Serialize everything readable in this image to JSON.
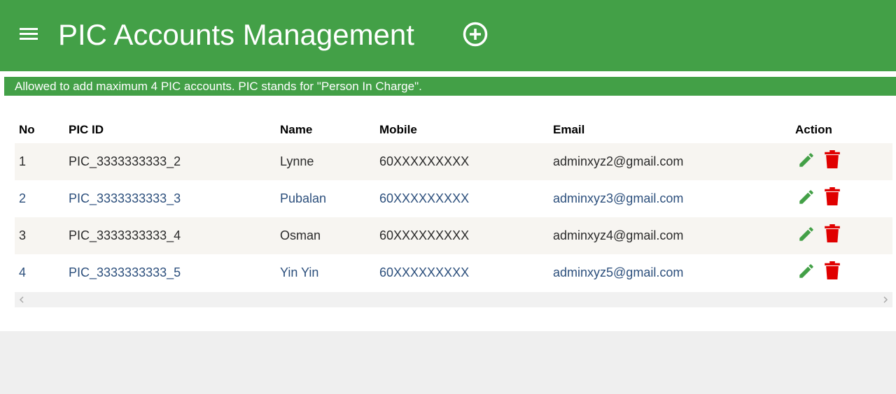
{
  "header": {
    "title": "PIC Accounts Management",
    "menu_icon": "hamburger-menu-icon",
    "add_icon": "add-circle-icon",
    "background_color": "#43a047"
  },
  "notice": {
    "text": "Allowed to add maximum 4 PIC accounts. PIC stands for \"Person In Charge\"."
  },
  "table": {
    "columns": {
      "no": "No",
      "pic_id": "PIC ID",
      "name": "Name",
      "mobile": "Mobile",
      "email": "Email",
      "action": "Action"
    },
    "rows": [
      {
        "no": "1",
        "pic_id": "PIC_3333333333_2",
        "name": "Lynne",
        "mobile": "60XXXXXXXXX",
        "email": "adminxyz2@gmail.com"
      },
      {
        "no": "2",
        "pic_id": "PIC_3333333333_3",
        "name": "Pubalan",
        "mobile": "60XXXXXXXXX",
        "email": "adminxyz3@gmail.com"
      },
      {
        "no": "3",
        "pic_id": "PIC_3333333333_4",
        "name": "Osman",
        "mobile": "60XXXXXXXXX",
        "email": "adminxyz4@gmail.com"
      },
      {
        "no": "4",
        "pic_id": "PIC_3333333333_5",
        "name": "Yin Yin",
        "mobile": "60XXXXXXXXX",
        "email": "adminxyz5@gmail.com"
      }
    ],
    "row_actions": {
      "edit_icon": "pencil-edit-icon",
      "delete_icon": "trash-delete-icon",
      "edit_color": "#43a047",
      "delete_color": "#e00000"
    }
  }
}
